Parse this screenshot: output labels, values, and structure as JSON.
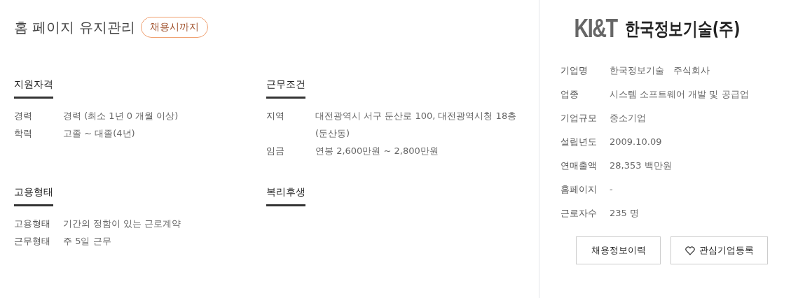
{
  "job": {
    "title": "홈 페이지 유지관리",
    "badge": "채용시까지"
  },
  "sections": [
    {
      "heading": "지원자격",
      "rows": [
        {
          "label": "경력",
          "value": "경력 (최소 1년 0 개월 이상)"
        },
        {
          "label": "학력",
          "value": "고졸 ~ 대졸(4년)"
        }
      ]
    },
    {
      "heading": "근무조건",
      "rows": [
        {
          "label": "지역",
          "value": "대전광역시 서구 둔산로 100, 대전광역시청 18층 (둔산동)"
        },
        {
          "label": "임금",
          "value": "연봉 2,600만원 ~ 2,800만원"
        }
      ]
    },
    {
      "heading": "고용형태",
      "rows": [
        {
          "label": "고용형태",
          "value": "기간의 정함이 있는 근로계약"
        },
        {
          "label": "근무형태",
          "value": "주 5일 근무"
        }
      ]
    },
    {
      "heading": "복리후생"
    }
  ],
  "company": {
    "logo": {
      "mark": "KI&T",
      "name": "한국정보기술(주)"
    },
    "rows": [
      {
        "label": "기업명",
        "value": "한국정보기술　주식회사"
      },
      {
        "label": "업종",
        "value": "시스템 소프트웨어 개발 및 공급업"
      },
      {
        "label": "기업규모",
        "value": "중소기업"
      },
      {
        "label": "설립년도",
        "value": "2009.10.09"
      },
      {
        "label": "연매출액",
        "value": "28,353 백만원"
      },
      {
        "label": "홈페이지",
        "value": "-"
      },
      {
        "label": "근로자수",
        "value": "235 명"
      }
    ],
    "buttons": [
      {
        "label": "채용정보이력",
        "kind": "plain"
      },
      {
        "label": "관심기업등록",
        "kind": "heart"
      }
    ]
  }
}
